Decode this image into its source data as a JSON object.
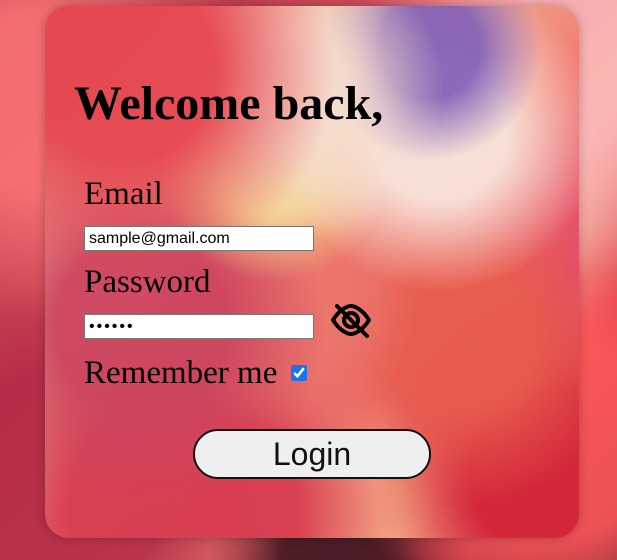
{
  "page": {
    "title": "Welcome back,"
  },
  "form": {
    "email_label": "Email",
    "email_value": "sample@gmail.com",
    "password_label": "Password",
    "password_value": "••••••",
    "remember_label": "Remember me",
    "remember_checked": true,
    "login_label": "Login",
    "password_toggle_icon": "eye-slash-icon"
  },
  "colors": {
    "accent": "#1a73e8",
    "button_background": "#efefef",
    "text": "#000000"
  }
}
